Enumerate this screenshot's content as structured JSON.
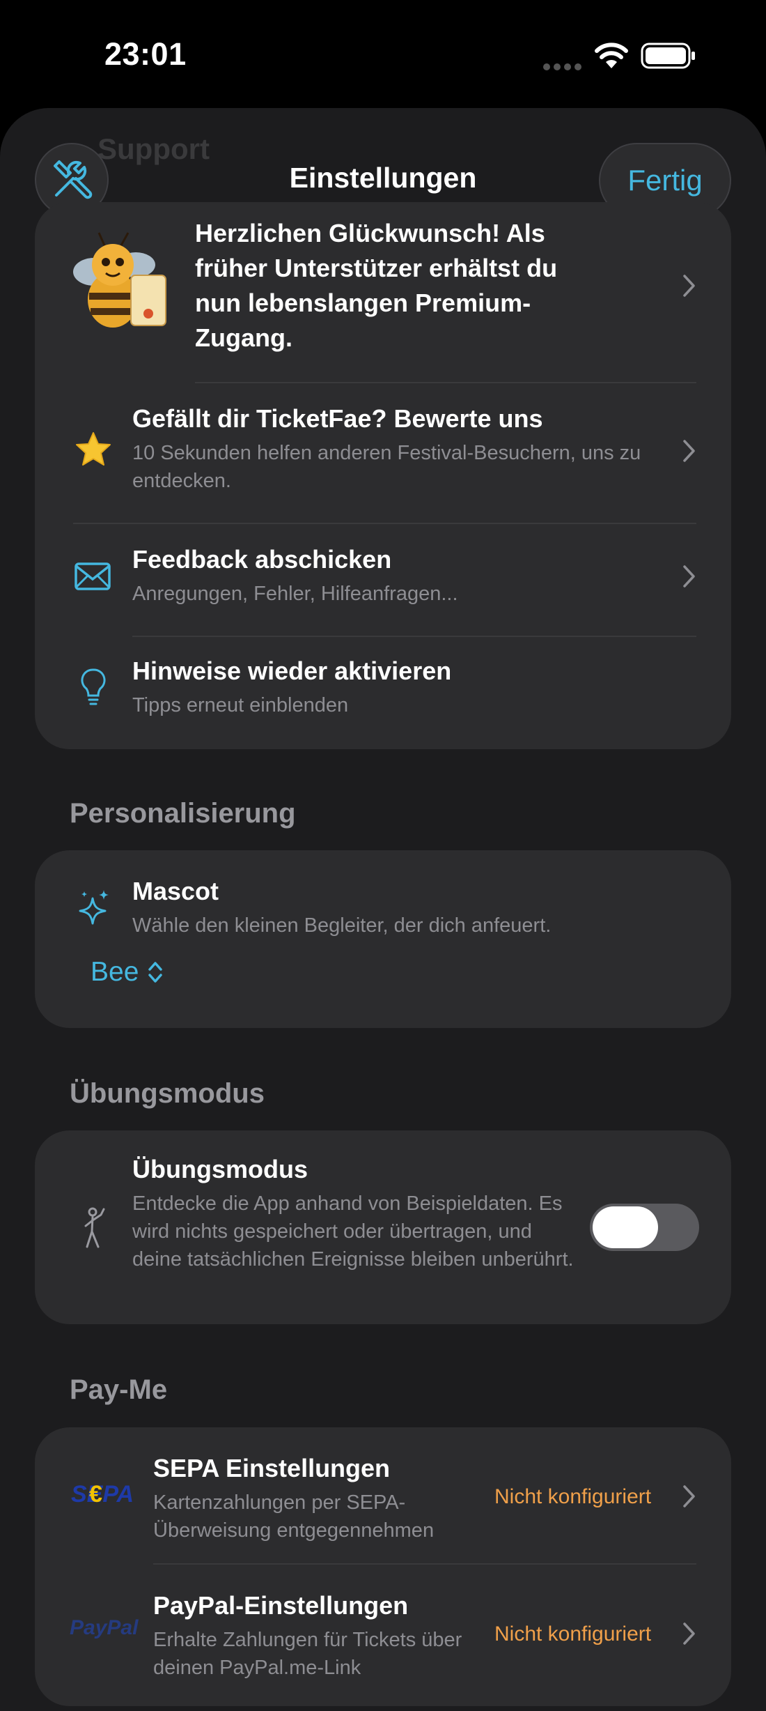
{
  "status_bar": {
    "time": "23:01"
  },
  "header": {
    "ghost_title": "Support",
    "title": "Einstellungen",
    "done_label": "Fertig"
  },
  "support": {
    "premium_text": "Herzlichen Glückwunsch! Als früher Unterstützer erhältst du nun lebenslangen Premium-Zugang.",
    "rate": {
      "title": "Gefällt dir TicketFae? Bewerte uns",
      "subtitle": "10 Sekunden helfen anderen Festival-Besuchern, uns zu entdecken."
    },
    "feedback": {
      "title": "Feedback abschicken",
      "subtitle": "Anregungen, Fehler, Hilfeanfragen..."
    },
    "hints": {
      "title": "Hinweise wieder aktivieren",
      "subtitle": "Tipps erneut einblenden"
    }
  },
  "personalization": {
    "header": "Personalisierung",
    "mascot": {
      "title": "Mascot",
      "subtitle": "Wähle den kleinen Begleiter, der dich anfeuert.",
      "selected": "Bee"
    }
  },
  "practice": {
    "header": "Übungsmodus",
    "title": "Übungsmodus",
    "subtitle": "Entdecke die App anhand von Beispieldaten. Es wird nichts gespeichert oder übertragen, und deine tatsächlichen Ereignisse bleiben unberührt.",
    "toggle_on": false
  },
  "payme": {
    "header": "Pay-Me",
    "sepa": {
      "logo_text": "SEPA",
      "title": "SEPA Einstellungen",
      "subtitle": "Kartenzahlungen per SEPA-Überweisung entgegennehmen",
      "status": "Nicht konfiguriert"
    },
    "paypal": {
      "logo_text": "PayPal",
      "title": "PayPal-Einstellungen",
      "subtitle": "Erhalte Zahlungen für Tickets über deinen PayPal.me-Link",
      "status": "Nicht konfiguriert"
    }
  },
  "colors": {
    "accent": "#45b8e0",
    "status_orange": "#f0a04a",
    "card": "#2c2c2e",
    "background": "#1c1c1e"
  }
}
